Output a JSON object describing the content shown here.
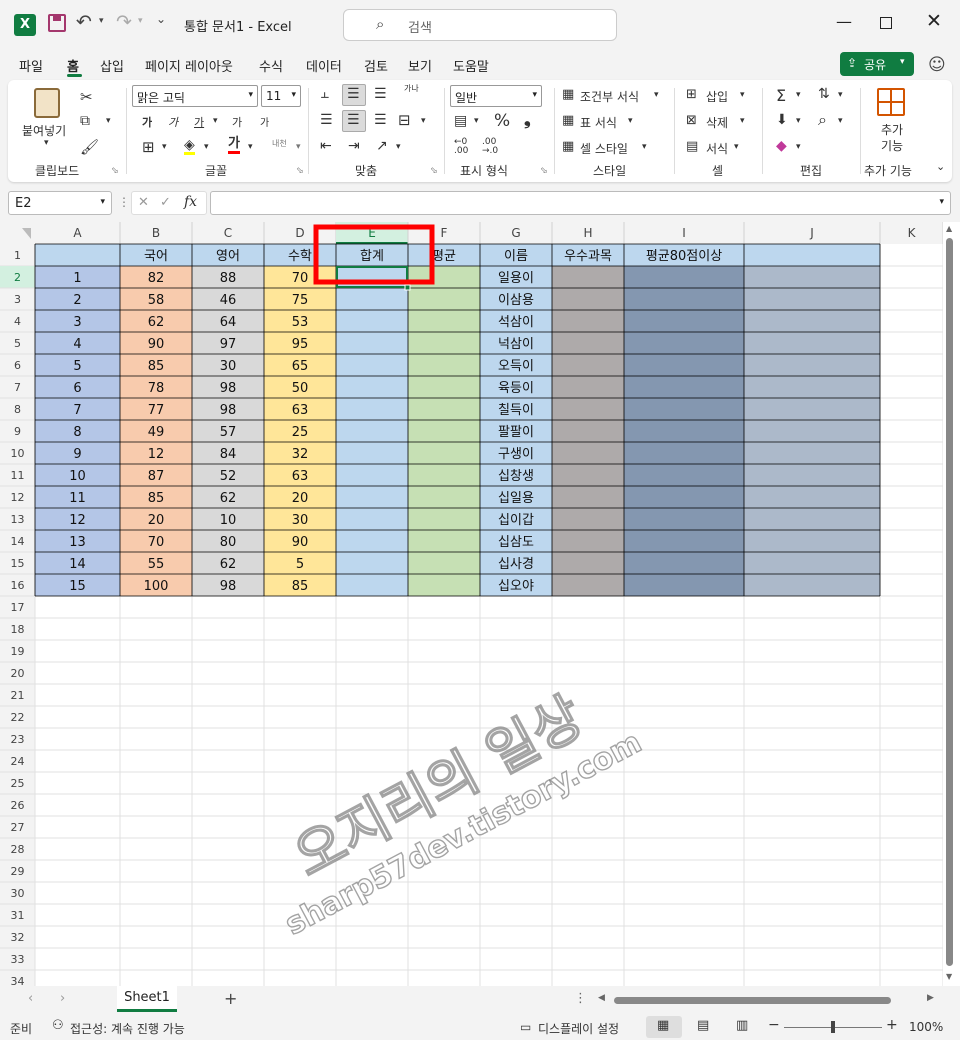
{
  "window": {
    "app_icon_letter": "X",
    "doc_title": "통합 문서1  -  Excel",
    "search_placeholder": "검색"
  },
  "menu": {
    "tabs": [
      "파일",
      "홈",
      "삽입",
      "페이지 레이아웃",
      "수식",
      "데이터",
      "검토",
      "보기",
      "도움말"
    ],
    "active": "홈",
    "share_label": "공유"
  },
  "ribbon": {
    "clipboard": {
      "paste": "붙여넣기",
      "group": "클립보드"
    },
    "font": {
      "name": "맑은 고딕",
      "size": "11",
      "group": "글꼴",
      "bold": "가",
      "italic": "가",
      "underline": "가",
      "grow": "가",
      "shrink": "가",
      "font_color": "가",
      "phonetic": "내천"
    },
    "align": {
      "group": "맞춤",
      "wrap": "가나"
    },
    "number": {
      "format": "일반",
      "group": "표시 형식"
    },
    "styles": {
      "cond": "조건부 서식",
      "table": "표 서식",
      "cell": "셀 스타일",
      "group": "스타일"
    },
    "cells": {
      "insert": "삽입",
      "delete": "삭제",
      "format": "서식",
      "group": "셀"
    },
    "editing": {
      "group": "편집"
    },
    "addins": {
      "label": "추가 기능",
      "group": "추가 기능"
    }
  },
  "formula_bar": {
    "name_box": "E2",
    "formula": ""
  },
  "sheet": {
    "columns": [
      "A",
      "B",
      "C",
      "D",
      "E",
      "F",
      "G",
      "H",
      "I",
      "J",
      "K"
    ],
    "headers": [
      "",
      "국어",
      "영어",
      "수학",
      "합계",
      "평균",
      "이름",
      "우수과목",
      "평균80점이상",
      ""
    ],
    "rows": [
      [
        1,
        82,
        88,
        70,
        "일용이"
      ],
      [
        2,
        58,
        46,
        75,
        "이삼용"
      ],
      [
        3,
        62,
        64,
        53,
        "석삼이"
      ],
      [
        4,
        90,
        97,
        95,
        "넉삼이"
      ],
      [
        5,
        85,
        30,
        65,
        "오득이"
      ],
      [
        6,
        78,
        98,
        50,
        "육등이"
      ],
      [
        7,
        77,
        98,
        63,
        "칠득이"
      ],
      [
        8,
        49,
        57,
        25,
        "팔팔이"
      ],
      [
        9,
        12,
        84,
        32,
        "구생이"
      ],
      [
        10,
        87,
        52,
        63,
        "십창생"
      ],
      [
        11,
        85,
        62,
        20,
        "십일용"
      ],
      [
        12,
        20,
        10,
        30,
        "십이갑"
      ],
      [
        13,
        70,
        80,
        90,
        "십삼도"
      ],
      [
        14,
        55,
        62,
        5,
        "십사경"
      ],
      [
        15,
        100,
        98,
        85,
        "십오야"
      ]
    ],
    "row_count": 34,
    "colors": {
      "A": "#b4c6e7",
      "B": "#f8cbad",
      "C": "#d9d9d9",
      "D": "#ffe699",
      "E": "#bdd7ee",
      "F": "#c6e0b4",
      "G": "#bdd7ee",
      "H": "#aeaaaa",
      "I": "#8497b0",
      "J": "#acb9ca",
      "header": "#bdd7ee",
      "accent": "#107c41",
      "highlight": "#ff0000"
    },
    "watermark": [
      "오지리의 일상",
      "sharp57dev.tistory.com"
    ]
  },
  "sheet_tabs": {
    "active": "Sheet1"
  },
  "status": {
    "ready": "준비",
    "accessibility": "접근성: 계속 진행 가능",
    "display": "디스플레이 설정",
    "zoom": "100%"
  }
}
